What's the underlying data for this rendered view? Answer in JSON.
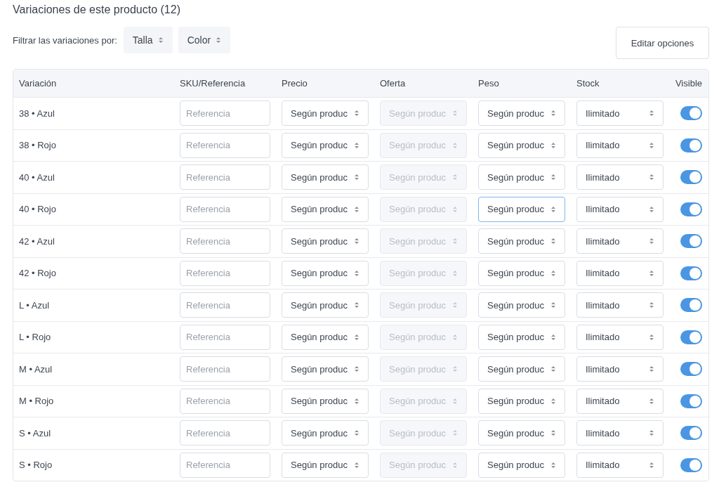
{
  "title": "Variaciones de este producto (12)",
  "filter": {
    "label": "Filtrar las variaciones por:",
    "options": [
      "Talla",
      "Color"
    ]
  },
  "edit_button": "Editar opciones",
  "table": {
    "columns": [
      "Variación",
      "SKU/Referencia",
      "Precio",
      "Oferta",
      "Peso",
      "Stock",
      "Visible"
    ],
    "rows": [
      {
        "variation": "38 • Azul",
        "sku": {
          "placeholder": "Referencia"
        },
        "price": {
          "value": "Según produc"
        },
        "offer": {
          "value": "Según produc",
          "disabled": true
        },
        "weight": {
          "value": "Según produc",
          "focused": false
        },
        "stock": {
          "value": "Ilimitado"
        },
        "visible": true
      },
      {
        "variation": "38 • Rojo",
        "sku": {
          "placeholder": "Referencia"
        },
        "price": {
          "value": "Según produc"
        },
        "offer": {
          "value": "Según produc",
          "disabled": true
        },
        "weight": {
          "value": "Según produc",
          "focused": false
        },
        "stock": {
          "value": "Ilimitado"
        },
        "visible": true
      },
      {
        "variation": "40 • Azul",
        "sku": {
          "placeholder": "Referencia"
        },
        "price": {
          "value": "Según produc"
        },
        "offer": {
          "value": "Según produc",
          "disabled": true
        },
        "weight": {
          "value": "Según produc",
          "focused": false
        },
        "stock": {
          "value": "Ilimitado"
        },
        "visible": true
      },
      {
        "variation": "40 • Rojo",
        "sku": {
          "placeholder": "Referencia"
        },
        "price": {
          "value": "Según produc"
        },
        "offer": {
          "value": "Según produc",
          "disabled": true
        },
        "weight": {
          "value": "Según produc",
          "focused": true
        },
        "stock": {
          "value": "Ilimitado"
        },
        "visible": true
      },
      {
        "variation": "42 • Azul",
        "sku": {
          "placeholder": "Referencia"
        },
        "price": {
          "value": "Según produc"
        },
        "offer": {
          "value": "Según produc",
          "disabled": true
        },
        "weight": {
          "value": "Según produc",
          "focused": false
        },
        "stock": {
          "value": "Ilimitado"
        },
        "visible": true
      },
      {
        "variation": "42 • Rojo",
        "sku": {
          "placeholder": "Referencia"
        },
        "price": {
          "value": "Según produc"
        },
        "offer": {
          "value": "Según produc",
          "disabled": true
        },
        "weight": {
          "value": "Según produc",
          "focused": false
        },
        "stock": {
          "value": "Ilimitado"
        },
        "visible": true
      },
      {
        "variation": "L • Azul",
        "sku": {
          "placeholder": "Referencia"
        },
        "price": {
          "value": "Según produc"
        },
        "offer": {
          "value": "Según produc",
          "disabled": true
        },
        "weight": {
          "value": "Según produc",
          "focused": false
        },
        "stock": {
          "value": "Ilimitado"
        },
        "visible": true
      },
      {
        "variation": "L • Rojo",
        "sku": {
          "placeholder": "Referencia"
        },
        "price": {
          "value": "Según produc"
        },
        "offer": {
          "value": "Según produc",
          "disabled": true
        },
        "weight": {
          "value": "Según produc",
          "focused": false
        },
        "stock": {
          "value": "Ilimitado"
        },
        "visible": true
      },
      {
        "variation": "M • Azul",
        "sku": {
          "placeholder": "Referencia"
        },
        "price": {
          "value": "Según produc"
        },
        "offer": {
          "value": "Según produc",
          "disabled": true
        },
        "weight": {
          "value": "Según produc",
          "focused": false
        },
        "stock": {
          "value": "Ilimitado"
        },
        "visible": true
      },
      {
        "variation": "M • Rojo",
        "sku": {
          "placeholder": "Referencia"
        },
        "price": {
          "value": "Según produc"
        },
        "offer": {
          "value": "Según produc",
          "disabled": true
        },
        "weight": {
          "value": "Según produc",
          "focused": false
        },
        "stock": {
          "value": "Ilimitado"
        },
        "visible": true
      },
      {
        "variation": "S • Azul",
        "sku": {
          "placeholder": "Referencia"
        },
        "price": {
          "value": "Según produc"
        },
        "offer": {
          "value": "Según produc",
          "disabled": true
        },
        "weight": {
          "value": "Según produc",
          "focused": false
        },
        "stock": {
          "value": "Ilimitado"
        },
        "visible": true
      },
      {
        "variation": "S • Rojo",
        "sku": {
          "placeholder": "Referencia"
        },
        "price": {
          "value": "Según produc"
        },
        "offer": {
          "value": "Según produc",
          "disabled": true
        },
        "weight": {
          "value": "Según produc",
          "focused": false
        },
        "stock": {
          "value": "Ilimitado"
        },
        "visible": true
      }
    ]
  }
}
